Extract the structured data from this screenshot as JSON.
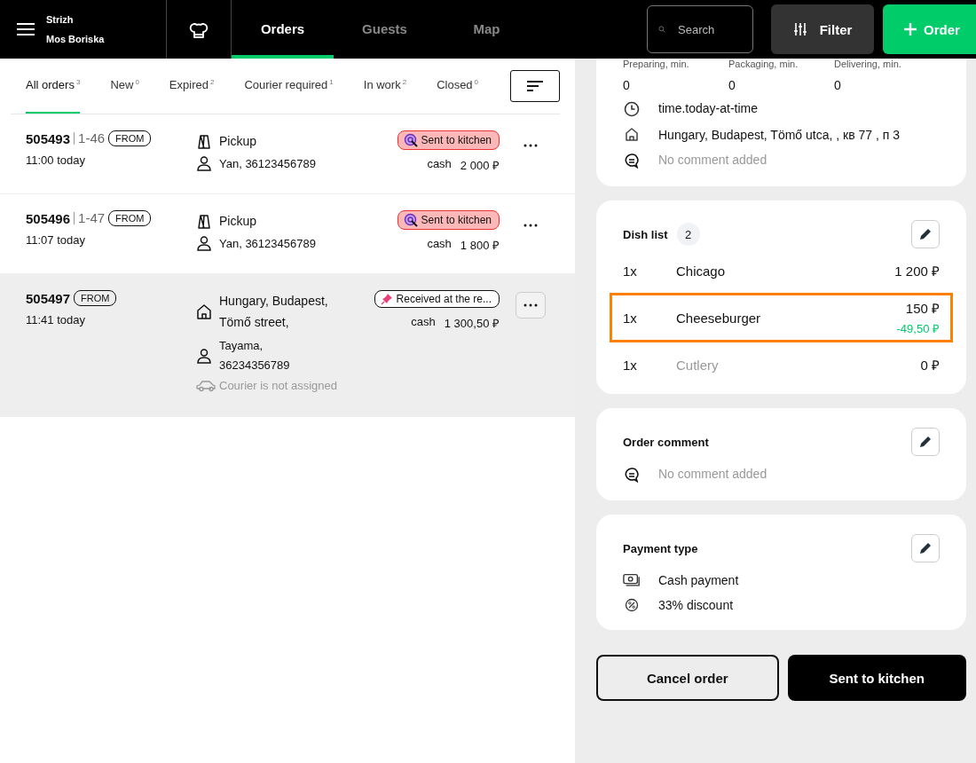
{
  "header": {
    "account": {
      "line_1": "Strizh",
      "line_2": "Mos Boriska"
    },
    "nav_tabs": [
      {
        "label": "Orders",
        "selected": true
      },
      {
        "label": "Guests",
        "selected": false
      },
      {
        "label": "Map",
        "selected": false
      }
    ],
    "search": {
      "placeholder": "Search"
    },
    "filter_button": "Filter",
    "order_button": "Order"
  },
  "filter_tabs": [
    {
      "label": "All orders",
      "count": "3",
      "selected": true
    },
    {
      "label": "New",
      "count": "0",
      "selected": false
    },
    {
      "label": "Expired",
      "count": "2",
      "selected": false
    },
    {
      "label": "Courier required",
      "count": "1",
      "selected": false
    },
    {
      "label": "In work",
      "count": "2",
      "selected": false
    },
    {
      "label": "Closed",
      "count": "0",
      "selected": false
    }
  ],
  "orders": [
    {
      "number": "505493",
      "table": "1-46",
      "source": "FROM",
      "time": "11:00 today",
      "kind": "pickup",
      "place": "Pickup",
      "customer": "Yan, 36123456789",
      "status": {
        "kind": "sent",
        "label": "Sent to kitchen"
      },
      "payment": "cash",
      "amount": "2 000 ₽",
      "selected": false
    },
    {
      "number": "505496",
      "table": "1-47",
      "source": "FROM",
      "time": "11:07 today",
      "kind": "pickup",
      "place": "Pickup",
      "customer": "Yan, 36123456789",
      "status": {
        "kind": "sent",
        "label": "Sent to kitchen"
      },
      "payment": "cash",
      "amount": "1 800 ₽",
      "selected": false
    },
    {
      "number": "505497",
      "source": "FROM",
      "time": "11:41 today",
      "kind": "delivery",
      "place": "Hungary, Budapest, Tömő street,",
      "customer": "Tayama, 36234356789",
      "courier": "Courier is not assigned",
      "status": {
        "kind": "received",
        "label": "Received at the re..."
      },
      "payment": "cash",
      "amount": "1 300,50 ₽",
      "selected": true
    }
  ],
  "details": {
    "timings": [
      {
        "label": "Preparing, min.",
        "value": "0"
      },
      {
        "label": "Packaging, min.",
        "value": "0"
      },
      {
        "label": "Delivering, min.",
        "value": "0"
      }
    ],
    "time": "time.today-at-time",
    "address": "Hungary, Budapest, Tömő utca, , кв 77 , п 3",
    "comment": "No comment added",
    "dish_list": {
      "title": "Dish list",
      "count": "2",
      "items": [
        {
          "qty": "1x",
          "name": "Chicago",
          "price": "1 200 ₽",
          "highlighted": false,
          "muted": false
        },
        {
          "qty": "1x",
          "name": "Cheeseburger",
          "price": "150 ₽",
          "discount": "-49,50 ₽",
          "highlighted": true,
          "muted": false
        },
        {
          "qty": "1x",
          "name": "Cutlery",
          "price": "0 ₽",
          "highlighted": false,
          "muted": true
        }
      ]
    },
    "order_comment": {
      "title": "Order comment",
      "text": "No comment added"
    },
    "payment": {
      "title": "Payment type",
      "method": "Cash payment",
      "discount": "33% discount"
    },
    "cancel_button": "Cancel order",
    "send_button": "Sent to kitchen"
  }
}
